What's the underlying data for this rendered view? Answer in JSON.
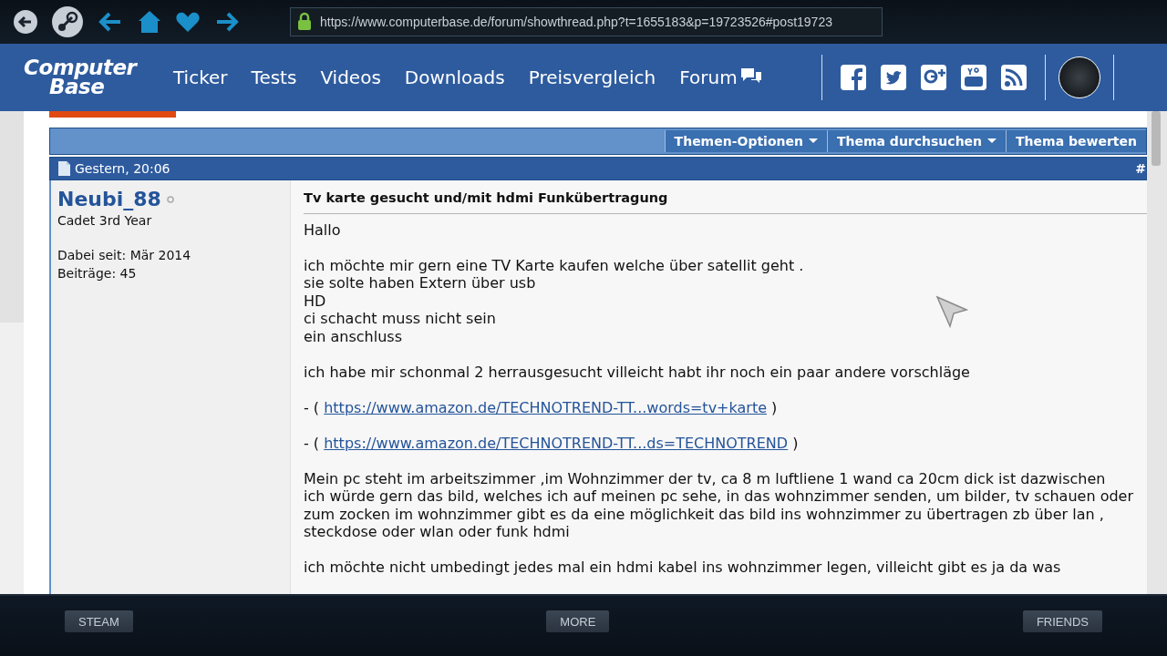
{
  "browser": {
    "url": "https://www.computerbase.de/forum/showthread.php?t=1655183&p=19723526#post19723"
  },
  "site": {
    "logo_top": "Computer",
    "logo_bottom": "Base",
    "nav": [
      {
        "label": "Ticker"
      },
      {
        "label": "Tests"
      },
      {
        "label": "Videos"
      },
      {
        "label": "Downloads"
      },
      {
        "label": "Preisvergleich"
      },
      {
        "label": "Forum",
        "badge": true
      }
    ]
  },
  "thread_tools": [
    {
      "label": "Themen-Optionen",
      "dropdown": true
    },
    {
      "label": "Thema durchsuchen",
      "dropdown": true
    },
    {
      "label": "Thema bewerten",
      "dropdown": false
    }
  ],
  "post": {
    "date": "Gestern, 20:06",
    "number": "#",
    "author": {
      "name": "Neubi_88",
      "online": false,
      "rank": "Cadet 3rd Year",
      "joined": "Dabei seit: Mär 2014",
      "posts": "Beiträge: 45"
    },
    "title": "Tv karte gesucht und/mit hdmi Funkübertragung",
    "blocks": [
      {
        "kind": "paragraph",
        "lines": [
          "Hallo"
        ]
      },
      {
        "kind": "paragraph",
        "lines": [
          "ich möchte mir gern eine TV Karte kaufen welche über satellit geht .",
          "sie solte haben Extern über usb",
          "HD",
          "ci schacht muss nicht sein",
          "ein anschluss"
        ]
      },
      {
        "kind": "paragraph",
        "lines": [
          "ich habe mir schonmal 2 herrausgesucht villeicht habt ihr noch ein paar andere vorschläge"
        ]
      },
      {
        "kind": "link",
        "prefix": "- (",
        "url": "https://www.amazon.de/TECHNOTREND-TT...words=tv+karte",
        "suffix": ")"
      },
      {
        "kind": "link",
        "prefix": "- (",
        "url": "https://www.amazon.de/TECHNOTREND-TT...ds=TECHNOTREND",
        "suffix": ")"
      },
      {
        "kind": "paragraph",
        "lines": [
          "Mein pc steht im arbeitszimmer ,im Wohnzimmer der tv, ca 8 m luftliene 1 wand ca 20cm dick ist dazwischen",
          "ich würde gern das bild, welches ich auf meinen pc sehe, in das wohnzimmer senden, um bilder, tv schauen oder",
          "zum zocken im wohnzimmer gibt es da eine möglichkeit das bild ins wohnzimmer zu übertragen zb über lan ,",
          "steckdose oder wlan oder funk hdmi"
        ]
      },
      {
        "kind": "paragraph",
        "lines": [
          "ich möchte nicht umbedingt jedes mal ein hdmi kabel ins wohnzimmer legen, villeicht gibt es ja da was"
        ]
      }
    ]
  },
  "bottom_bar": [
    {
      "label": "STEAM"
    },
    {
      "label": "MORE"
    },
    {
      "label": "FRIENDS"
    }
  ]
}
